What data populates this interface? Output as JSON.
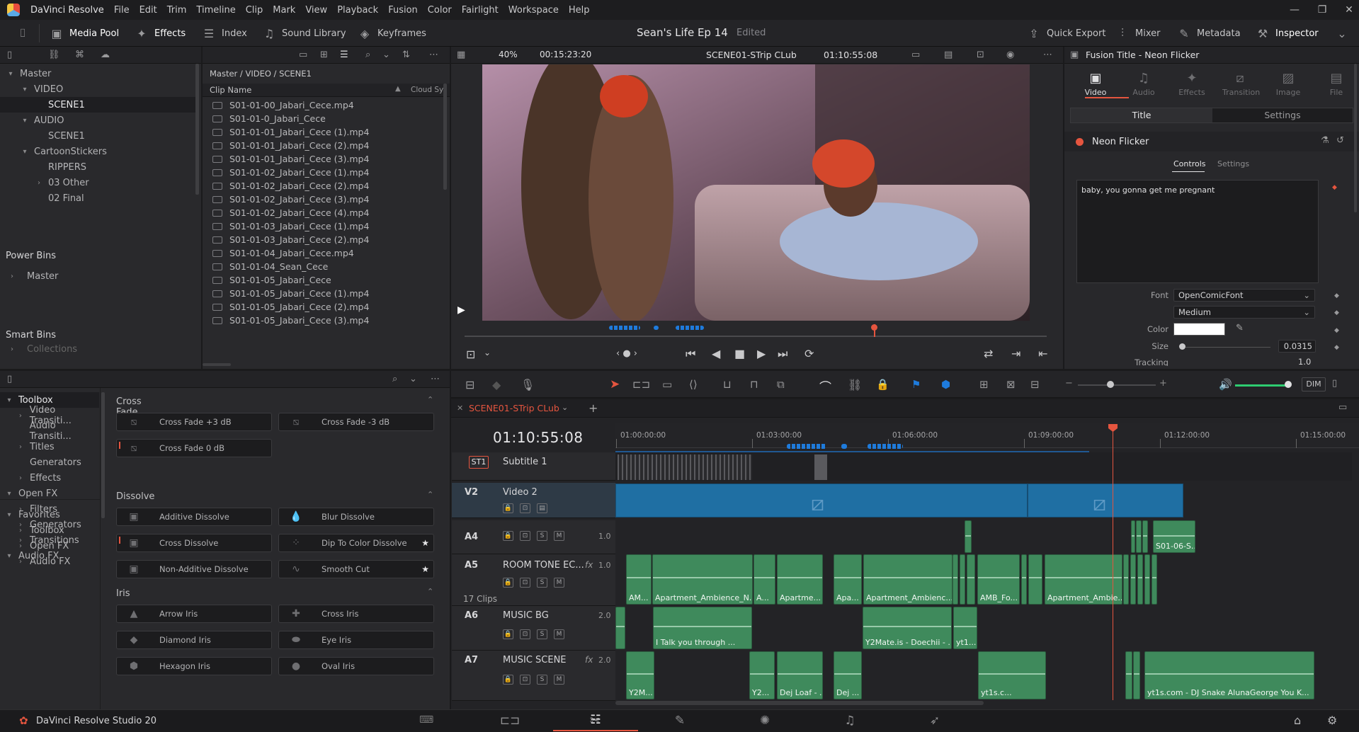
{
  "app": {
    "name": "DaVinci Resolve"
  },
  "menu": [
    "File",
    "Edit",
    "Trim",
    "Timeline",
    "Clip",
    "Mark",
    "View",
    "Playback",
    "Fusion",
    "Color",
    "Fairlight",
    "Workspace",
    "Help"
  ],
  "toolbar": {
    "media_pool": "Media Pool",
    "effects": "Effects",
    "index": "Index",
    "sound_library": "Sound Library",
    "keyframes": "Keyframes",
    "project_title": "Sean's Life Ep 14",
    "project_status": "Edited",
    "quick_export": "Quick Export",
    "mixer": "Mixer",
    "metadata": "Metadata",
    "inspector": "Inspector"
  },
  "media_pool": {
    "bins": [
      {
        "label": "Master",
        "depth": 0,
        "arrow": "▾"
      },
      {
        "label": "VIDEO",
        "depth": 1,
        "arrow": "▾"
      },
      {
        "label": "SCENE1",
        "depth": 2,
        "arrow": "",
        "selected": true
      },
      {
        "label": "AUDIO",
        "depth": 1,
        "arrow": "▾"
      },
      {
        "label": "SCENE1",
        "depth": 2,
        "arrow": ""
      },
      {
        "label": "CartoonStickers",
        "depth": 1,
        "arrow": "▾"
      },
      {
        "label": "RIPPERS",
        "depth": 2,
        "arrow": ""
      },
      {
        "label": "03 Other",
        "depth": 2,
        "arrow": "›"
      },
      {
        "label": "02 Final",
        "depth": 2,
        "arrow": ""
      }
    ],
    "power_bins_title": "Power Bins",
    "power_bins_master": "Master",
    "smart_bins_title": "Smart Bins",
    "smart_bins_collections": "Collections",
    "breadcrumb": "Master / VIDEO / SCENE1",
    "col_clip_name": "Clip Name",
    "col_cloud": "Cloud Sy",
    "clips": [
      "S01-01-00_Jabari_Cece.mp4",
      "S01-01-0_Jabari_Cece",
      "S01-01-01_Jabari_Cece (1).mp4",
      "S01-01-01_Jabari_Cece (2).mp4",
      "S01-01-01_Jabari_Cece (3).mp4",
      "S01-01-02_Jabari_Cece (1).mp4",
      "S01-01-02_Jabari_Cece (2).mp4",
      "S01-01-02_Jabari_Cece (3).mp4",
      "S01-01-02_Jabari_Cece (4).mp4",
      "S01-01-03_Jabari_Cece (1).mp4",
      "S01-01-03_Jabari_Cece (2).mp4",
      "S01-01-04_Jabari_Cece.mp4",
      "S01-01-04_Sean_Cece",
      "S01-01-05_Jabari_Cece",
      "S01-01-05_Jabari_Cece (1).mp4",
      "S01-01-05_Jabari_Cece (2).mp4",
      "S01-01-05_Jabari_Cece (3).mp4"
    ]
  },
  "effects": {
    "tree": [
      {
        "label": "Toolbox",
        "depth": 0,
        "arrow": "▾",
        "selected": true
      },
      {
        "label": "Video Transiti...",
        "depth": 1,
        "arrow": "›"
      },
      {
        "label": "Audio Transiti...",
        "depth": 1,
        "arrow": ""
      },
      {
        "label": "Titles",
        "depth": 1,
        "arrow": "›"
      },
      {
        "label": "Generators",
        "depth": 1,
        "arrow": ""
      },
      {
        "label": "Effects",
        "depth": 1,
        "arrow": "›"
      },
      {
        "label": "Open FX",
        "depth": 0,
        "arrow": "▾"
      },
      {
        "label": "Filters",
        "depth": 1,
        "arrow": "›"
      },
      {
        "label": "Generators",
        "depth": 1,
        "arrow": "›"
      },
      {
        "label": "Transitions",
        "depth": 1,
        "arrow": "›"
      },
      {
        "label": "Audio FX",
        "depth": 0,
        "arrow": "▾"
      }
    ],
    "favorites": [
      {
        "label": "Favorites",
        "depth": 0,
        "arrow": "▾"
      },
      {
        "label": "Toolbox",
        "depth": 1,
        "arrow": "›"
      },
      {
        "label": "Open FX",
        "depth": 1,
        "arrow": "›"
      },
      {
        "label": "Audio FX",
        "depth": 1,
        "arrow": "›"
      }
    ],
    "groups": [
      {
        "title": "Cross Fade",
        "items": [
          "Cross Fade +3 dB",
          "Cross Fade -3 dB",
          "Cross Fade 0 dB"
        ]
      },
      {
        "title": "Dissolve",
        "items": [
          "Additive Dissolve",
          "Blur Dissolve",
          "Cross Dissolve",
          "Dip To Color Dissolve",
          "Non-Additive Dissolve",
          "Smooth Cut"
        ]
      },
      {
        "title": "Iris",
        "items": [
          "Arrow Iris",
          "Cross Iris",
          "Diamond Iris",
          "Eye Iris",
          "Hexagon Iris",
          "Oval Iris"
        ]
      }
    ]
  },
  "viewer": {
    "zoom": "40%",
    "duration": "00:15:23:20",
    "timeline_name": "SCENE01-STrip CLub",
    "timecode": "01:10:55:08"
  },
  "timeline": {
    "tab": "SCENE01-STrip CLub",
    "timecode": "01:10:55:08",
    "ruler": [
      "01:00:00:00",
      "01:03:00:00",
      "01:06:00:00",
      "01:09:00:00",
      "01:12:00:00",
      "01:15:00:00"
    ],
    "tracks": [
      {
        "id": "ST1",
        "name": "Subtitle 1"
      },
      {
        "id": "V2",
        "name": "Video 2"
      },
      {
        "id": "A4",
        "name": "",
        "vol": "1.0"
      },
      {
        "id": "A5",
        "name": "ROOM TONE EC...",
        "vol": "1.0",
        "fx": "fx",
        "clips_count": "17 Clips"
      },
      {
        "id": "A6",
        "name": "MUSIC BG",
        "vol": "2.0"
      },
      {
        "id": "A7",
        "name": "MUSIC SCENE",
        "vol": "2.0",
        "fx": "fx"
      }
    ],
    "clip_labels": {
      "a4": "S01-06-S...",
      "a5": [
        "AM...",
        "Apartment_Ambience_N...",
        "A...",
        "Apartme...",
        "Apa...",
        "Apartment_Ambienc...",
        "AMB_Fo...",
        "Apartment_Ambie..."
      ],
      "a6": [
        "I Talk you through ...",
        "Y2Mate.is - Doechii - ...",
        "yt1..."
      ],
      "a7": [
        "Y2M...",
        "Y2...",
        "Dej Loaf - ...",
        "Dej ...",
        "yt1s.c...",
        "yt1s.com - DJ Snake  AlunaGeorge  You K..."
      ]
    },
    "dim": "DIM"
  },
  "inspector": {
    "title": "Fusion Title - Neon Flicker",
    "tabs": [
      "Video",
      "Audio",
      "Effects",
      "Transition",
      "Image",
      "File"
    ],
    "sub_tabs": [
      "Title",
      "Settings"
    ],
    "effect_name": "Neon Flicker",
    "ctrl_tabs": [
      "Controls",
      "Settings"
    ],
    "text_value": "baby, you gonna get me pregnant",
    "font_label": "Font",
    "font_value": "OpenComicFont",
    "font_style": "Medium",
    "color_label": "Color",
    "size_label": "Size",
    "size_value": "0.0315",
    "tracking_label": "Tracking",
    "tracking_value": "1.0"
  },
  "bottom": {
    "app_label": "DaVinci Resolve Studio 20"
  },
  "colors": {
    "accent": "#e5553f",
    "audio_clip": "#3f8a5c",
    "video_clip": "#1f6fa3",
    "marker_blue": "#1e7bdc"
  }
}
